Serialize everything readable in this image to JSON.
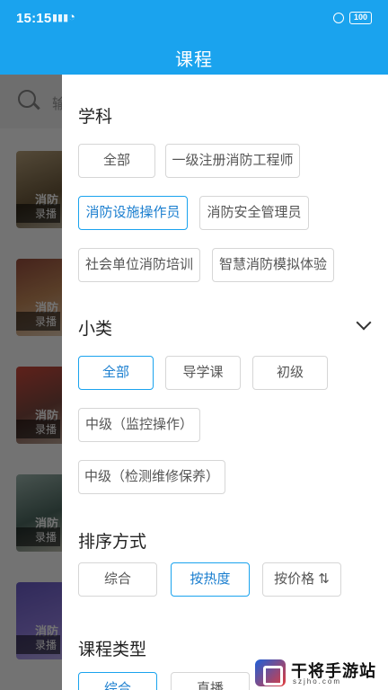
{
  "status_bar": {
    "time": "15:15",
    "battery": "100"
  },
  "header": {
    "title": "课程"
  },
  "background": {
    "search_placeholder": "输",
    "courses": [
      {
        "title": "消防",
        "tag": "录播"
      },
      {
        "title": "消防",
        "tag": "录播"
      },
      {
        "title": "消防",
        "tag": "录播"
      },
      {
        "title": "消防",
        "tag": "录播"
      },
      {
        "title": "消防",
        "tag": "录播"
      }
    ]
  },
  "filter": {
    "subject": {
      "title": "学科",
      "options": [
        "全部",
        "一级注册消防工程师",
        "消防设施操作员",
        "消防安全管理员",
        "社会单位消防培训",
        "智慧消防模拟体验"
      ],
      "selected": "消防设施操作员"
    },
    "subcategory": {
      "title": "小类",
      "options": [
        "全部",
        "导学课",
        "初级",
        "中级（监控操作）",
        "中级（检测维修保养）"
      ],
      "selected": "全部"
    },
    "sort": {
      "title": "排序方式",
      "options": [
        "综合",
        "按热度",
        "按价格 ⇅"
      ],
      "selected": "按热度"
    },
    "course_type": {
      "title": "课程类型",
      "options": [
        "综合",
        "直播"
      ],
      "selected": "综合"
    }
  },
  "watermark": {
    "name": "干将手游站",
    "url": "szjho.com"
  },
  "colors": {
    "accent": "#1aa3ee",
    "chip_border": "#d6d6d6",
    "selected_text": "#1a7ecf"
  }
}
